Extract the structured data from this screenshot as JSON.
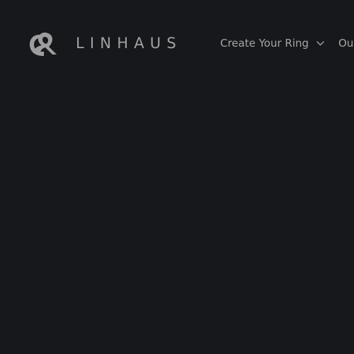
{
  "brand": {
    "name": "LINHAUS",
    "logo_icon": "ampersand-logo-icon"
  },
  "nav": {
    "items": [
      {
        "label": "Create Your Ring",
        "icon": "chevron-down-icon"
      },
      {
        "label": "Ou"
      }
    ]
  },
  "colors": {
    "background": "#17181c",
    "text": "#a6a6a6"
  }
}
